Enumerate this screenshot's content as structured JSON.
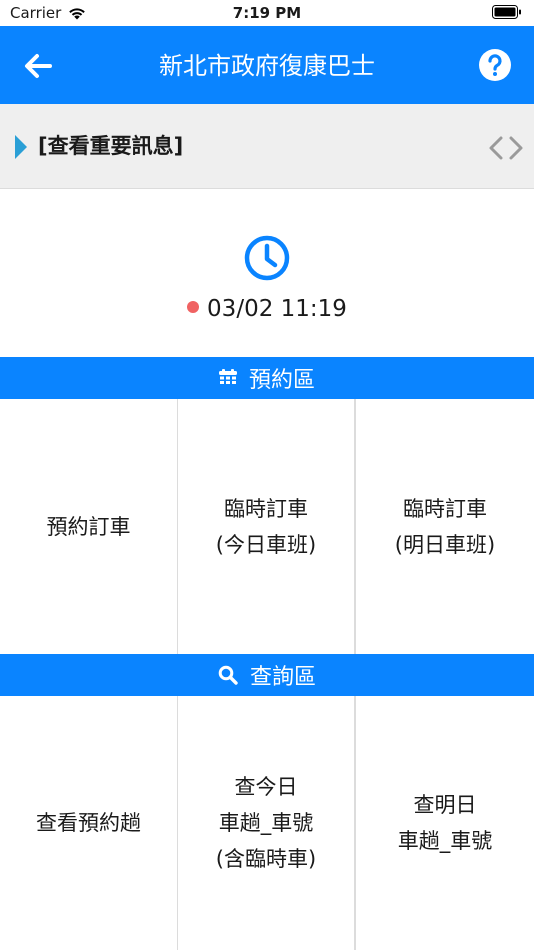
{
  "status_bar": {
    "carrier": "Carrier",
    "time": "7:19 PM"
  },
  "nav": {
    "title": "新北市政府復康巴士"
  },
  "marquee": {
    "message": "[查看重要訊息]"
  },
  "clock_panel": {
    "time": "03/02 11:19"
  },
  "reservation": {
    "title": "預約區",
    "items": [
      {
        "label": "預約訂車"
      },
      {
        "label": "臨時訂車\n(今日車班)"
      },
      {
        "label": "臨時訂車\n(明日車班)"
      }
    ]
  },
  "query": {
    "title": "查詢區",
    "items": [
      {
        "label": "查看預約趟"
      },
      {
        "label": "查今日\n車趟_車號\n(含臨時車)"
      },
      {
        "label": "查明日\n車趟_車號"
      }
    ]
  },
  "colors": {
    "accent": "#0a84ff",
    "status_dot": "#f06262",
    "background_gray": "#efefef"
  },
  "icons": [
    "wifi-icon",
    "battery-icon",
    "back-arrow-icon",
    "help-icon",
    "play-icon",
    "chevron-left-icon",
    "chevron-right-icon",
    "clock-icon",
    "calendar-icon",
    "search-icon"
  ]
}
